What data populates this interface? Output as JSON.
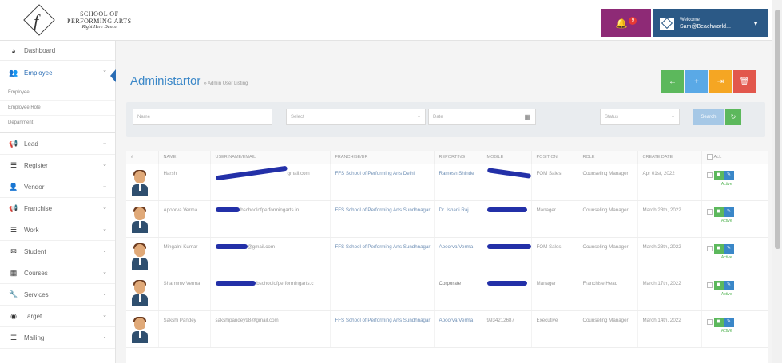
{
  "brand": {
    "line1": "SCHOOL OF",
    "line2": "PERFORMING ARTS",
    "tagline": "Right Here Dance"
  },
  "header": {
    "notif_count": "9",
    "welcome": "Welcome",
    "user_name": "Sam@Beachworld..."
  },
  "sidebar": {
    "dashboard": "Dashboard",
    "employee": "Employee",
    "sub_items": [
      "Employee",
      "Employee Role",
      "Department"
    ],
    "items": [
      "Lead",
      "Register",
      "Vendor",
      "Franchise",
      "Work",
      "Student",
      "Courses",
      "Services",
      "Target",
      "Mailing"
    ]
  },
  "page": {
    "title": "Administartor",
    "subtitle": "» Admin User Listing"
  },
  "filters": {
    "name": "Name",
    "select1": "Select",
    "date": "Date",
    "select2": "Status",
    "search": "Search"
  },
  "table": {
    "headers": [
      "#",
      "NAME",
      "USER NAME/EMAIL",
      "FRANCHISE/BR",
      "REPORTING",
      "MOBILE",
      "POSITION",
      "ROLE",
      "CREATE DATE",
      "ALL"
    ],
    "rows": [
      {
        "name": "Harshi",
        "email": "gmail.com",
        "franchise": "FFS School of Performing Arts Delhi",
        "reporting": "Ramesh Shinde",
        "position": "FOM Sales",
        "role": "Counseling Manager",
        "date": "Apr 01st, 2022",
        "status": "Active"
      },
      {
        "name": "Apoorva Verma",
        "email": "fbschoolofperformingarts.in",
        "franchise": "FFS School of Performing Arts Sundhnagar",
        "reporting": "Dr. Ishani Raj",
        "position": "Manager",
        "role": "Counseling Manager",
        "date": "March 28th, 2022",
        "status": "Active"
      },
      {
        "name": "Mingalni Kumar",
        "email": "@gmail.com",
        "franchise": "FFS School of Performing Arts Sundhnagar",
        "reporting": "Apoorva Verma",
        "position": "FOM Sales",
        "role": "Counseling Manager",
        "date": "March 28th, 2022",
        "status": "Active"
      },
      {
        "name": "Sharmmv Verma",
        "email": "fbschoolofperformingarts.c",
        "franchise": "",
        "reporting": "Corporate",
        "position": "Manager",
        "role": "Franchise Head",
        "date": "March 17th, 2022",
        "status": "Active"
      },
      {
        "name": "Sakshi Pandey",
        "email": "sakshipandey98@gmail.com",
        "franchise": "FFS School of Performing Arts Sundhnagar",
        "reporting": "Apoorva Verma",
        "mobile": "9934212687",
        "position": "Executive",
        "role": "Counseling Manager",
        "date": "March 14th, 2022",
        "status": "Active"
      }
    ]
  }
}
